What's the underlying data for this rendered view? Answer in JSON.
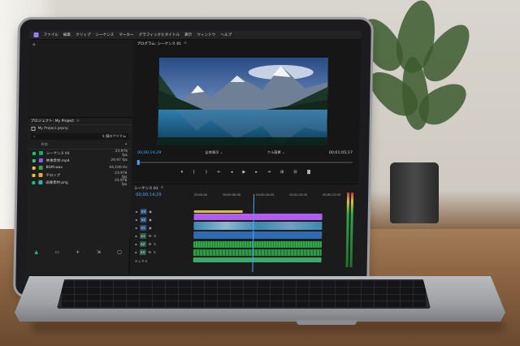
{
  "menu": {
    "items": [
      "ファイル",
      "編集",
      "クリップ",
      "シーケンス",
      "マーカー",
      "グラフィックとタイトル",
      "表示",
      "ウィンドウ",
      "ヘルプ"
    ]
  },
  "project": {
    "tab_label": "プロジェクト: My Project",
    "file_name": "My Project.prproj",
    "item_count": "5 個のアイテム",
    "column_name": "名前",
    "items": [
      {
        "name": "シーケンス 01",
        "rate": "23,976 fps",
        "color": "#1fc27a",
        "icon": "sequence-icon",
        "icon_color": "#1fa36a"
      },
      {
        "name": "映像素材.mp4",
        "rate": "29,97 fps",
        "color": "#3fbf88",
        "icon": "video-file-icon",
        "icon_color": "#8a5cf0"
      },
      {
        "name": "BGM.wav",
        "rate": "44,100 Hz",
        "color": "#e7c04a",
        "icon": "audio-file-icon",
        "icon_color": "#2fa84a"
      },
      {
        "name": "テロップ",
        "rate": "23,976 fps",
        "color": "#e7c04a",
        "icon": "title-icon",
        "icon_color": "#e7a43a"
      },
      {
        "name": "画像素材.png",
        "rate": "23,976 fps",
        "color": "#1fc27a",
        "icon": "image-file-icon",
        "icon_color": "#2fb89a"
      }
    ]
  },
  "program": {
    "tab_label": "プログラム: シーケンス 01",
    "timecode_current": "00;00;14;29",
    "fit_dropdown": "全体表示",
    "quality_dropdown": "フル画質",
    "timecode_duration": "00;01;05;17"
  },
  "timeline": {
    "tab_label": "シーケンス 01",
    "timecode": "00;00;14;29",
    "ruler": [
      "00;00;00",
      "00;00;08;00",
      "00;00;16;00",
      "00;00;24;00",
      "00;00;32;00"
    ],
    "tracks": [
      "V3",
      "V2",
      "V1",
      "A1",
      "A2",
      "A3"
    ],
    "mix_label": "ミックス"
  },
  "colors": {
    "accent_blue": "#4aa3ff",
    "clip_purple": "#b05cf0",
    "clip_video": "#3a8ab0",
    "clip_audio": "#2fa84a"
  }
}
